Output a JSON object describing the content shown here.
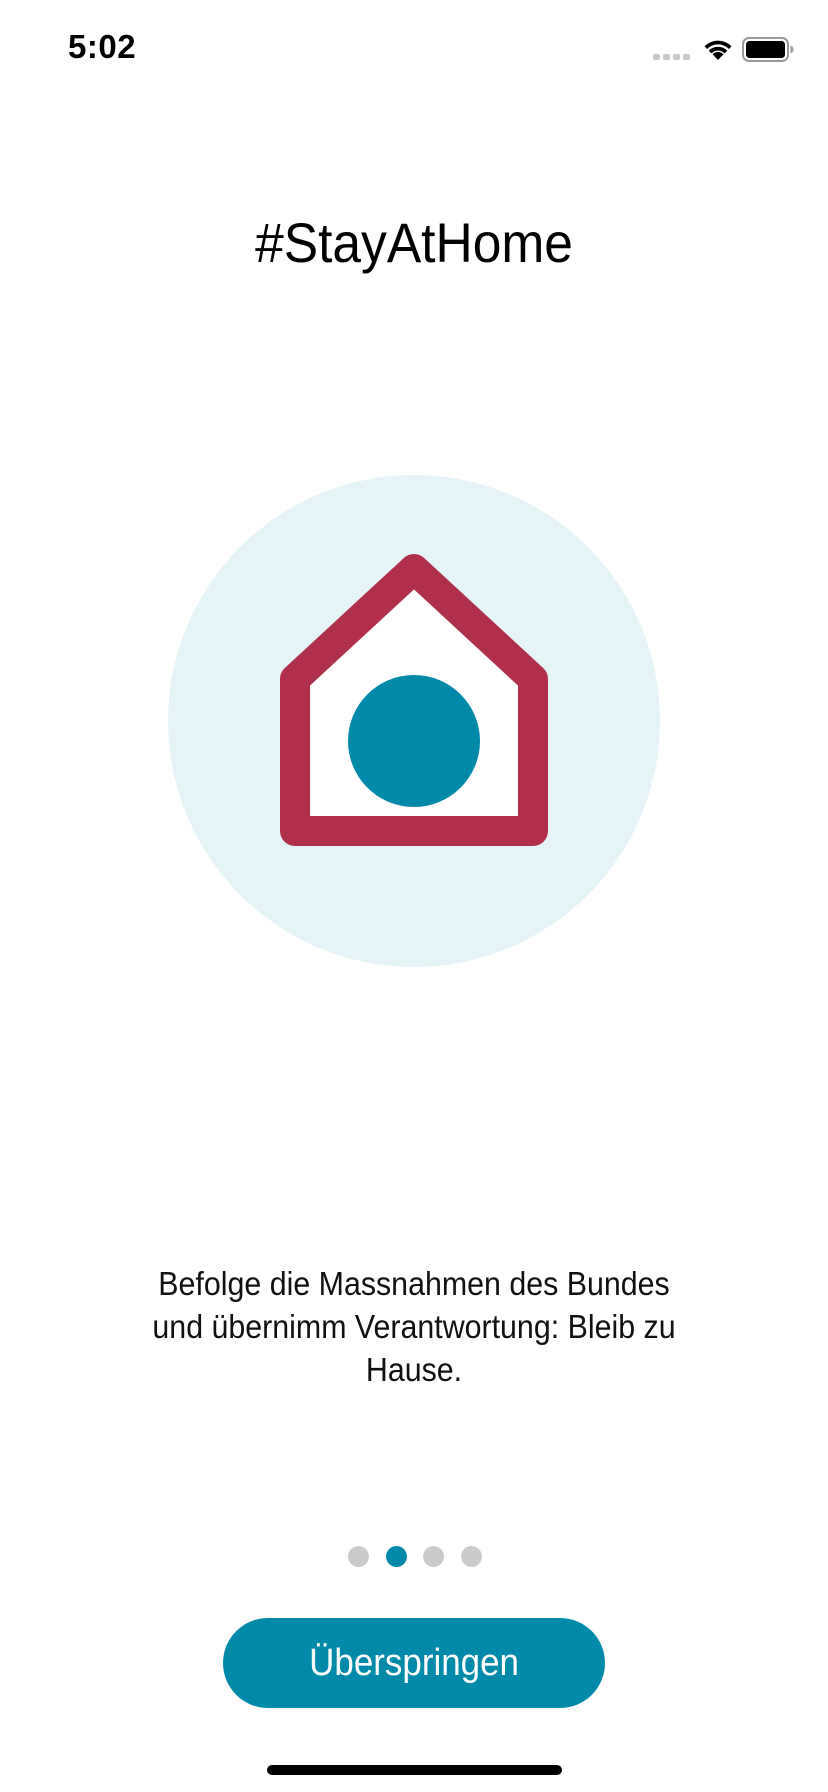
{
  "status_bar": {
    "time": "5:02",
    "icons": [
      "cellular-signal-icon",
      "wifi-icon",
      "battery-icon"
    ]
  },
  "onboarding": {
    "title": "#StayAtHome",
    "illustration": "house-with-person-icon",
    "description": "Befolge die Massnahmen des Bundes und übernimm Verantwortung: Bleib zu Hause.",
    "pager": {
      "page_count": 4,
      "current_page": 2
    },
    "skip_label": "Überspringen"
  },
  "colors": {
    "accent": "#0089a8",
    "house_outline": "#b0304c",
    "circle_background": "#e5f4f6",
    "inactive_dot": "#cbcbcb"
  }
}
